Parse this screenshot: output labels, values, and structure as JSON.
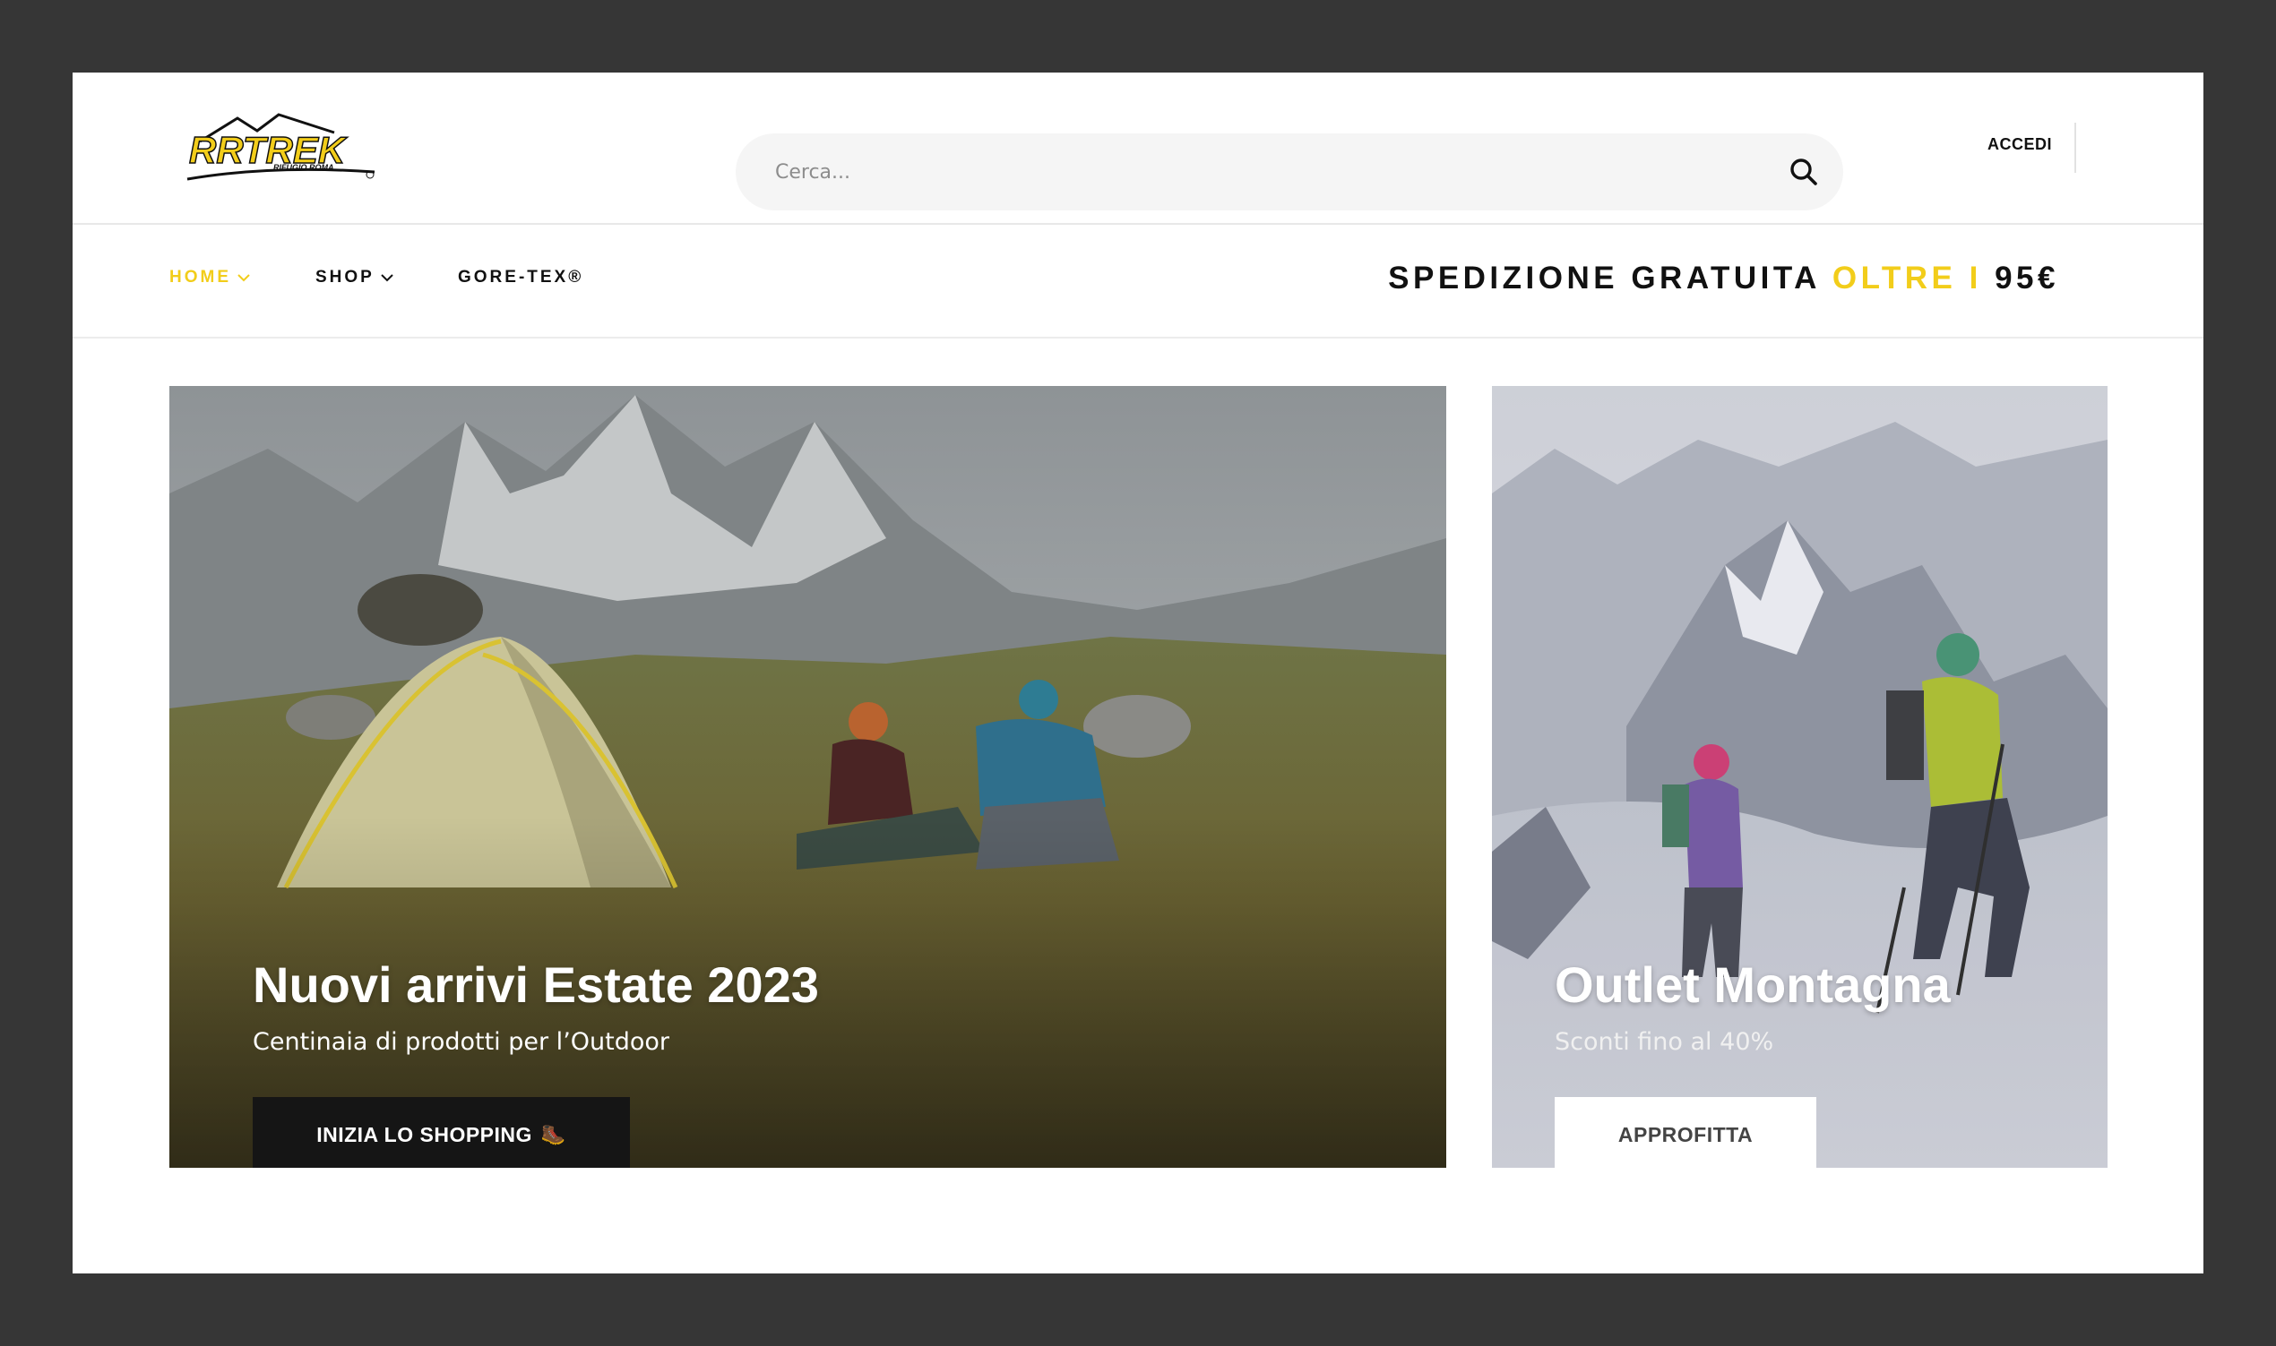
{
  "header": {
    "logo_text": "RRTREK",
    "logo_subtext": "RIFUGIO ROMA",
    "search_placeholder": "Cerca...",
    "login_label": "ACCEDI"
  },
  "nav": {
    "items": [
      {
        "label": "HOME",
        "active": true,
        "has_dropdown": true
      },
      {
        "label": "SHOP",
        "active": false,
        "has_dropdown": true
      },
      {
        "label": "GORE-TEX®",
        "active": false,
        "has_dropdown": false
      }
    ]
  },
  "promo": {
    "part1": "SPEDIZIONE GRATUITA",
    "part2": "OLTRE I",
    "part3": "95€"
  },
  "banners": {
    "left": {
      "title": "Nuovi arrivi Estate 2023",
      "subtitle": "Centinaia di prodotti per l’Outdoor",
      "cta_label": "INIZIA LO SHOPPING",
      "cta_emoji": "🥾"
    },
    "right": {
      "title": "Outlet Montagna",
      "subtitle": "Sconti fino al 40%",
      "cta_label": "APPROFITTA"
    }
  },
  "colors": {
    "accent": "#f2cd1a",
    "frame": "#363636",
    "dark_button": "#151515"
  }
}
